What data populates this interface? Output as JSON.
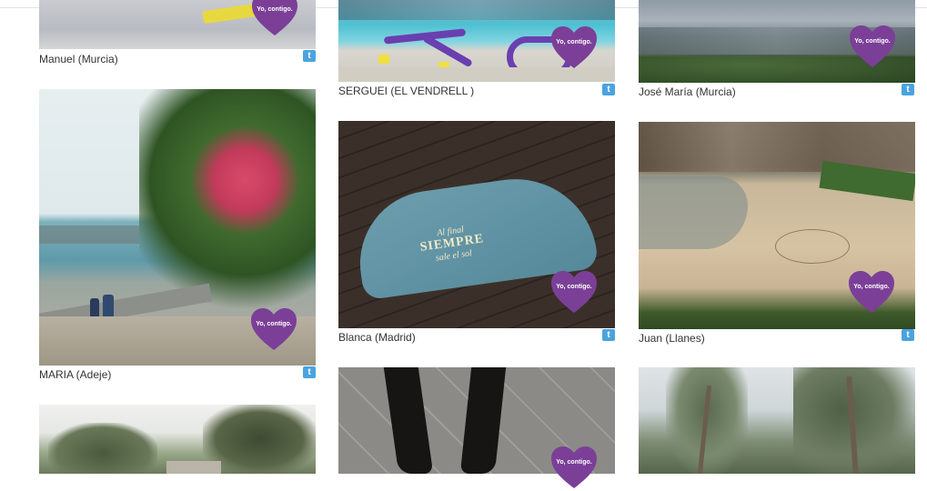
{
  "badge": {
    "text": "Yo, contigo.",
    "color": "#7b3f98"
  },
  "share_icon": "twitter-icon",
  "share_glyph": "t",
  "cards": [
    {
      "caption": "Manuel (Murcia)"
    },
    {
      "caption": "SERGUEI (EL VENDRELL )"
    },
    {
      "caption": "José María (Murcia)"
    },
    {
      "caption": "MARIA (Adeje)"
    },
    {
      "caption": "Blanca (Madrid)"
    },
    {
      "caption": "Juan (Llanes)"
    }
  ],
  "umbrella_print": {
    "line1": "Al final",
    "line2": "SIEMPRE",
    "line3": "sale el sol"
  }
}
